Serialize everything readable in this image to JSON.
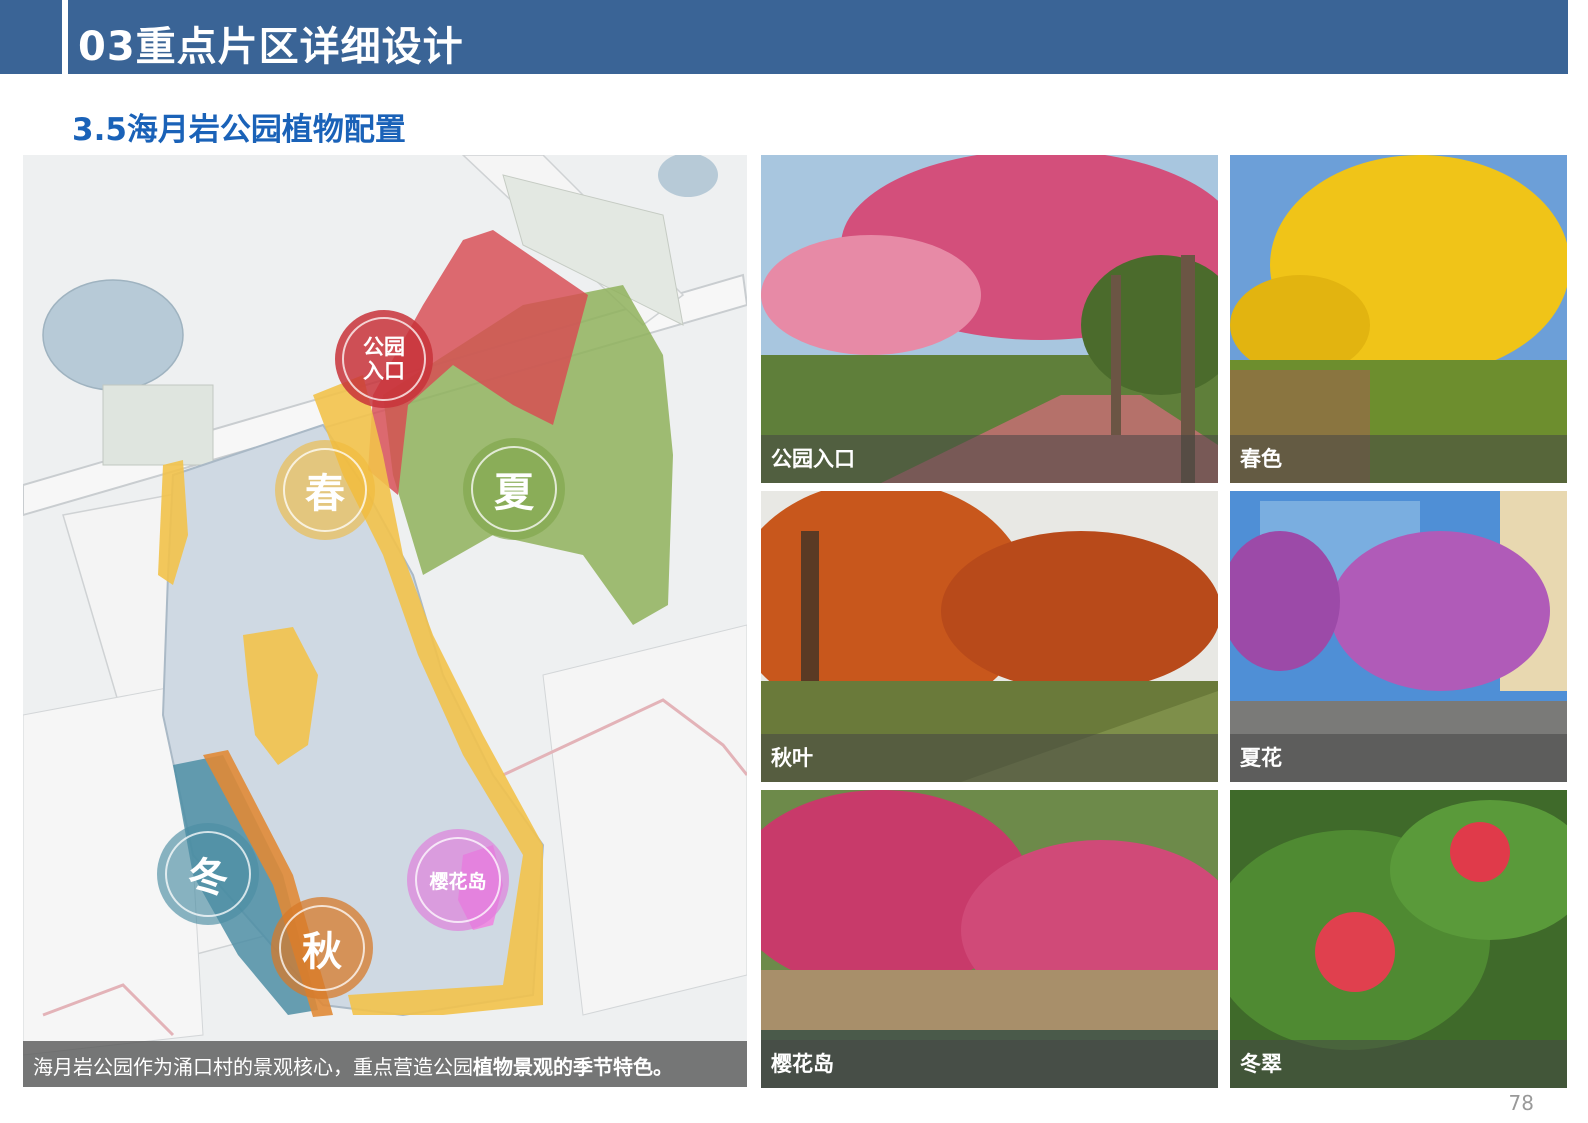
{
  "header": {
    "title": "03重点片区详细设计"
  },
  "subtitle": "3.5海月岩公园植物配置",
  "map": {
    "caption_normal": "海月岩公园作为涌口村的景观核心，重点营造公园",
    "caption_bold": "植物景观的季节特色。",
    "badges": {
      "entrance": "公园入口",
      "spring": "春",
      "summer": "夏",
      "winter": "冬",
      "autumn": "秋",
      "sakura": "樱花岛"
    }
  },
  "photos": [
    {
      "label": "公园入口"
    },
    {
      "label": "春色"
    },
    {
      "label": "秋叶"
    },
    {
      "label": "夏花"
    },
    {
      "label": "樱花岛"
    },
    {
      "label": "冬翠"
    }
  ],
  "page_number": "78",
  "colors": {
    "header": "#3a6496",
    "subtitle": "#1a62b8",
    "entrance": "#c8323a",
    "spring": "#f0b93a",
    "summer": "#7fa64a",
    "winter": "#4c8ea3",
    "autumn": "#d77a2a",
    "sakura": "#e07bdc"
  }
}
